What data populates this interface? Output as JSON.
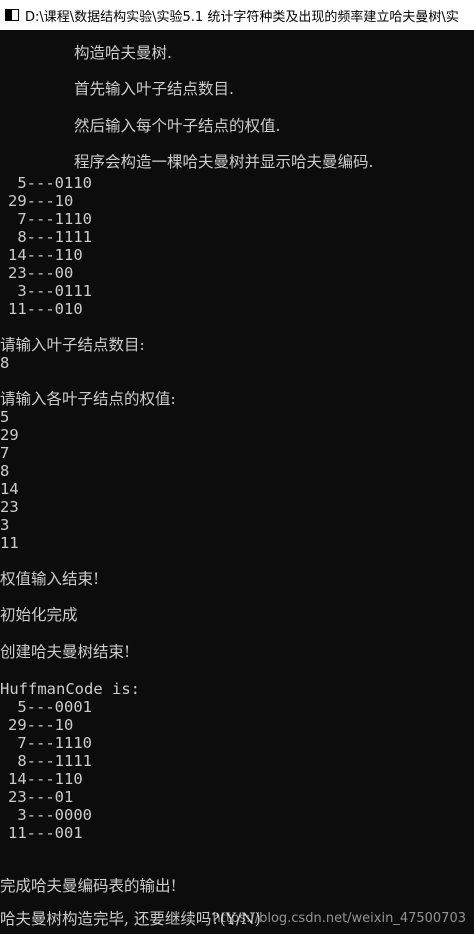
{
  "window": {
    "title": "D:\\课程\\数据结构实验\\实验5.1 统计字符种类及出现的频率建立哈夫曼树\\实"
  },
  "intro": {
    "l1": "构造哈夫曼树.",
    "l2": "首先输入叶子结点数目.",
    "l3": "然后输入每个叶子结点的权值.",
    "l4": "程序会构造一棵哈夫曼树并显示哈夫曼编码."
  },
  "first_codes": [
    " 5---0110",
    "29---10",
    " 7---1110",
    " 8---1111",
    "14---110",
    "23---00",
    " 3---0111",
    "11---010"
  ],
  "prompt_count": "请输入叶子结点数目:",
  "count_value": "8",
  "prompt_weights": "请输入各叶子结点的权值:",
  "weights": [
    "5",
    "29",
    "7",
    "8",
    "14",
    "23",
    "3",
    "11"
  ],
  "msg_weights_done": "权值输入结束!",
  "msg_init_done": "初始化完成",
  "msg_tree_done": "创建哈夫曼树结束!",
  "huffman_header": "HuffmanCode is:",
  "second_codes": [
    " 5---0001",
    "29---10",
    " 7---1110",
    " 8---1111",
    "14---110",
    "23---01",
    " 3---0000",
    "11---001"
  ],
  "msg_output_done": "完成哈夫曼编码表的输出!",
  "msg_continue": "哈夫曼树构造完毕, 还要继续吗?(Y/N)",
  "watermark": "https://blog.csdn.net/weixin_47500703"
}
